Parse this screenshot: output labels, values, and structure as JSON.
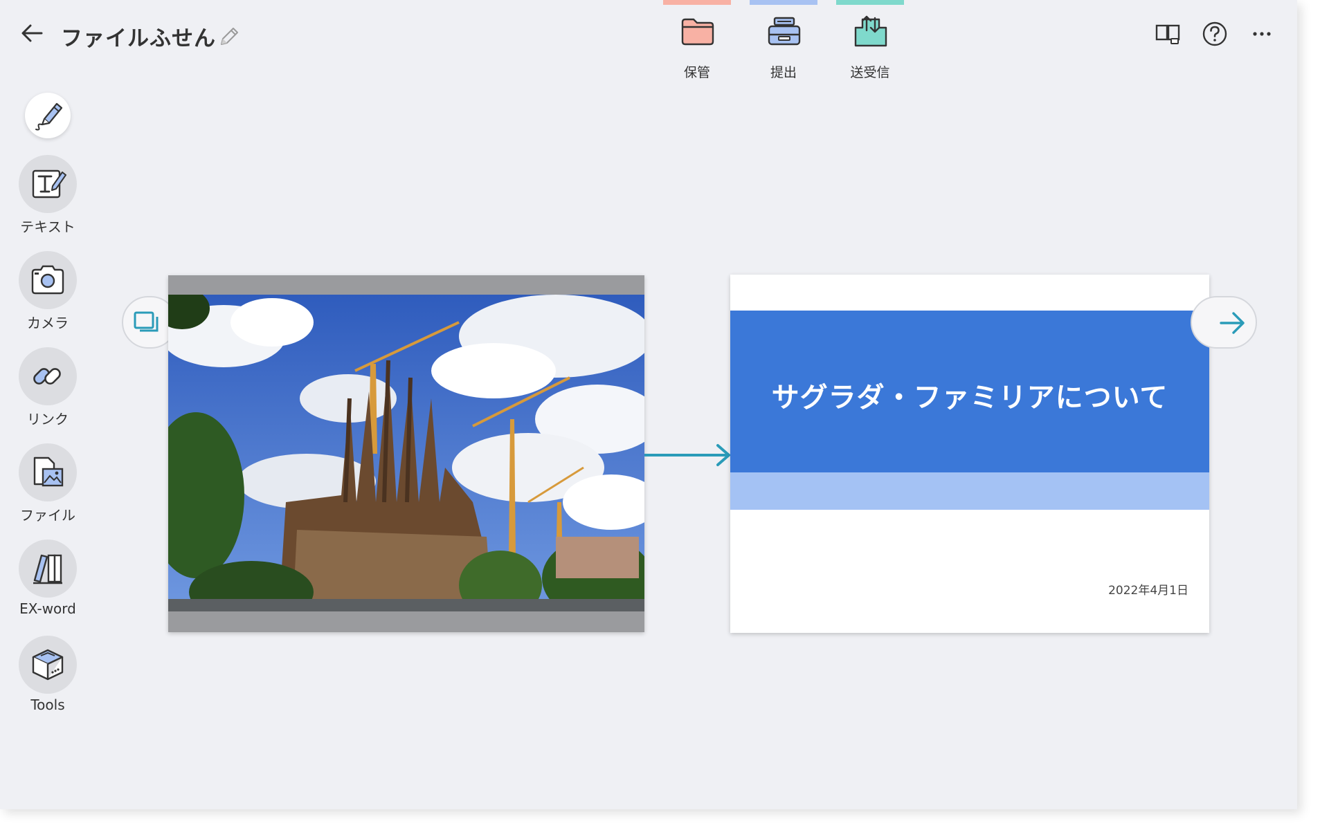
{
  "header": {
    "title": "ファイルふせん",
    "tabs": [
      {
        "label": "保管",
        "color": "#f8b1a4"
      },
      {
        "label": "提出",
        "color": "#a8c2f2"
      },
      {
        "label": "送受信",
        "color": "#7fd9cc"
      }
    ],
    "right_icons": [
      "layout-icon",
      "help-icon",
      "more-icon"
    ]
  },
  "sidebar": {
    "items": [
      {
        "label": "",
        "icon": "pen-icon"
      },
      {
        "label": "テキスト",
        "icon": "text-icon"
      },
      {
        "label": "カメラ",
        "icon": "camera-icon"
      },
      {
        "label": "リンク",
        "icon": "link-icon"
      },
      {
        "label": "ファイル",
        "icon": "file-icon"
      },
      {
        "label": "EX-word",
        "icon": "dictionary-icon"
      },
      {
        "label": "Tools",
        "icon": "tools-icon"
      }
    ]
  },
  "canvas": {
    "cards": [
      {
        "type": "photo",
        "icon": "photo-icon"
      },
      {
        "type": "slide",
        "title": "サグラダ・ファミリアについて",
        "date": "2022年4月1日"
      }
    ]
  },
  "colors": {
    "accent": "#2a9bb8",
    "slide_band": "#3b78d8",
    "slide_subband": "#a4c2f4",
    "background": "#eff0f4"
  }
}
